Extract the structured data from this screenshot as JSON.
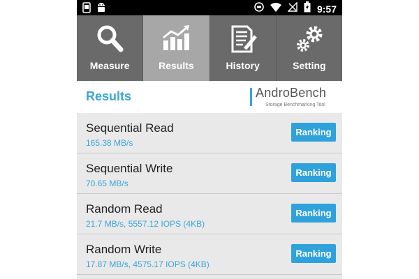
{
  "status_bar": {
    "time": "9:57",
    "icons": [
      "phone-screenshot-icon",
      "android-robot-icon",
      "sync-icon",
      "wifi-icon",
      "no-signal-icon",
      "battery-charging-icon"
    ]
  },
  "tabs": [
    {
      "label": "Measure",
      "icon": "magnifier-icon",
      "active": false
    },
    {
      "label": "Results",
      "icon": "bar-chart-icon",
      "active": true
    },
    {
      "label": "History",
      "icon": "document-pen-icon",
      "active": false
    },
    {
      "label": "Setting",
      "icon": "gears-icon",
      "active": false
    }
  ],
  "header": {
    "title": "Results",
    "logo_name": "AndroBench",
    "logo_tagline": "Storage Benchmarking Tool"
  },
  "results": [
    {
      "title": "Sequential Read",
      "value": "165.38 MB/s",
      "button": "Ranking"
    },
    {
      "title": "Sequential Write",
      "value": "70.65 MB/s",
      "button": "Ranking"
    },
    {
      "title": "Random Read",
      "value": "21.7 MB/s, 5557.12 IOPS (4KB)",
      "button": "Ranking"
    },
    {
      "title": "Random Write",
      "value": "17.87 MB/s, 4575.17 IOPS (4KB)",
      "button": "Ranking"
    }
  ],
  "colors": {
    "accent": "#3aa6d8",
    "button": "#2fa2dc",
    "tab_bg": "#6a6a6a",
    "tab_active_bg": "#a7a7a7",
    "row_bg": "#e9e9e9"
  }
}
